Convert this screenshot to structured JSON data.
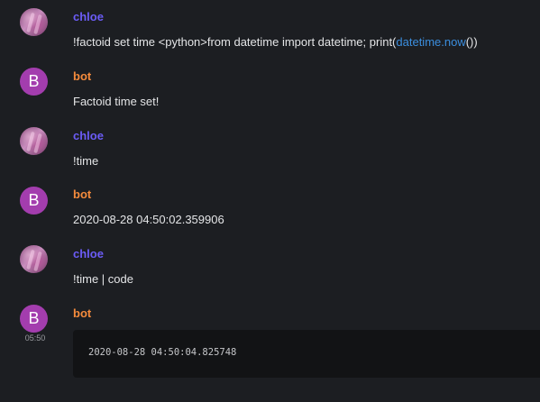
{
  "messages": [
    {
      "author": "chloe",
      "avatar": "photo",
      "text_before": "!factoid set time <python>from datetime import datetime; print(",
      "link_text": "datetime.now",
      "text_after": "())"
    },
    {
      "author": "bot",
      "avatar_letter": "B",
      "text": "Factoid time set!"
    },
    {
      "author": "chloe",
      "avatar": "photo",
      "text": "!time"
    },
    {
      "author": "bot",
      "avatar_letter": "B",
      "text": "2020-08-28 04:50:02.359906"
    },
    {
      "author": "chloe",
      "avatar": "photo",
      "text": "!time | code"
    },
    {
      "author": "bot",
      "avatar_letter": "B",
      "timestamp": "05:50",
      "code": "2020-08-28 04:50:04.825748"
    }
  ],
  "colors": {
    "background": "#1c1e22",
    "user_name": "#6b5cf6",
    "bot_name": "#f58b3c",
    "bot_avatar": "#a33dae",
    "link": "#3b8ede",
    "codeblock_bg": "#121315"
  }
}
